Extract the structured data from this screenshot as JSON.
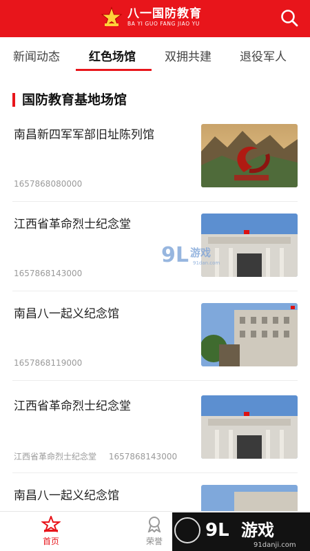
{
  "header": {
    "logo_title": "八一国防教育",
    "logo_subtitle": "BA YI GUO FANG JIAO YU",
    "brand_color": "#e8151b",
    "search_icon": "search-icon"
  },
  "tabs": [
    {
      "label": "新闻动态",
      "active": false
    },
    {
      "label": "红色场馆",
      "active": true
    },
    {
      "label": "双拥共建",
      "active": false
    },
    {
      "label": "退役军人",
      "active": false
    }
  ],
  "section": {
    "title": "国防教育基地场馆"
  },
  "articles": [
    {
      "title": "南昌新四军军部旧址陈列馆",
      "source": "",
      "timestamp": "1657868080000",
      "thumb": "sculpture-mountains"
    },
    {
      "title": "江西省革命烈士纪念堂",
      "source": "",
      "timestamp": "1657868143000",
      "thumb": "memorial-hall"
    },
    {
      "title": "南昌八一起义纪念馆",
      "source": "",
      "timestamp": "1657868119000",
      "thumb": "uprising-museum"
    },
    {
      "title": "江西省革命烈士纪念堂",
      "source": "江西省革命烈士纪念堂",
      "timestamp": "1657868143000",
      "thumb": "memorial-hall"
    },
    {
      "title": "南昌八一起义纪念馆",
      "source": "",
      "timestamp": "",
      "thumb": "uprising-museum"
    }
  ],
  "bottom_nav": [
    {
      "label": "首页",
      "icon": "home-emblem-icon",
      "active": true
    },
    {
      "label": "荣誉",
      "icon": "medal-icon",
      "active": false
    }
  ],
  "watermarks": {
    "center_logo": "9L",
    "center_text": "游戏",
    "center_url": "91dan.com",
    "bottom_logo": "9L",
    "bottom_text": "游戏",
    "bottom_url": "91danji.com"
  }
}
